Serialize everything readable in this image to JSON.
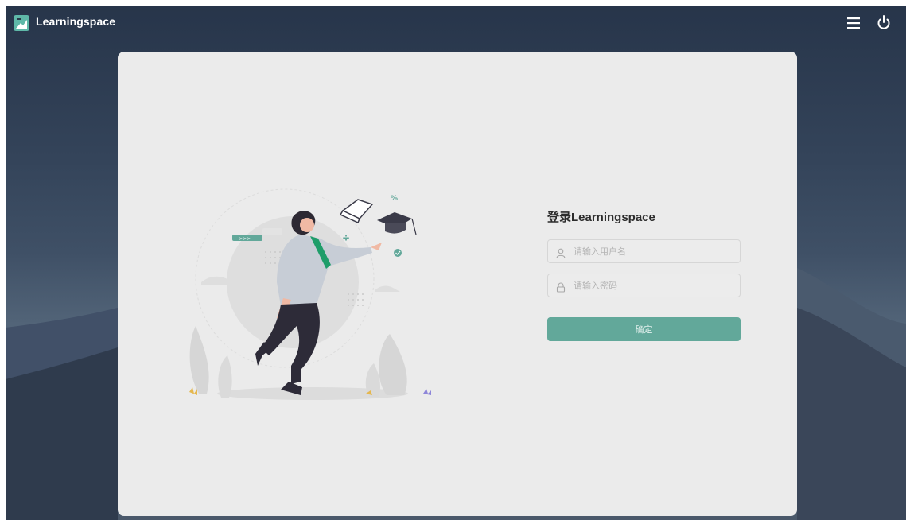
{
  "app": {
    "brand": "Learningspace",
    "icons": {
      "logo": "learningspace-logo-icon",
      "menu": "menu-icon",
      "power": "power-icon"
    }
  },
  "login": {
    "title": "登录Learningspace",
    "username_placeholder": "请输入用户名",
    "password_placeholder": "请输入密码",
    "submit_label": "确定",
    "icons": {
      "username": "user-icon",
      "password": "lock-icon"
    }
  },
  "illustration": {
    "badge_text": ">>>"
  },
  "colors": {
    "accent": "#62a89a",
    "figure_scarf": "#1e9d6a",
    "card_background": "#ebebeb",
    "logo": "#5fb8a8"
  }
}
